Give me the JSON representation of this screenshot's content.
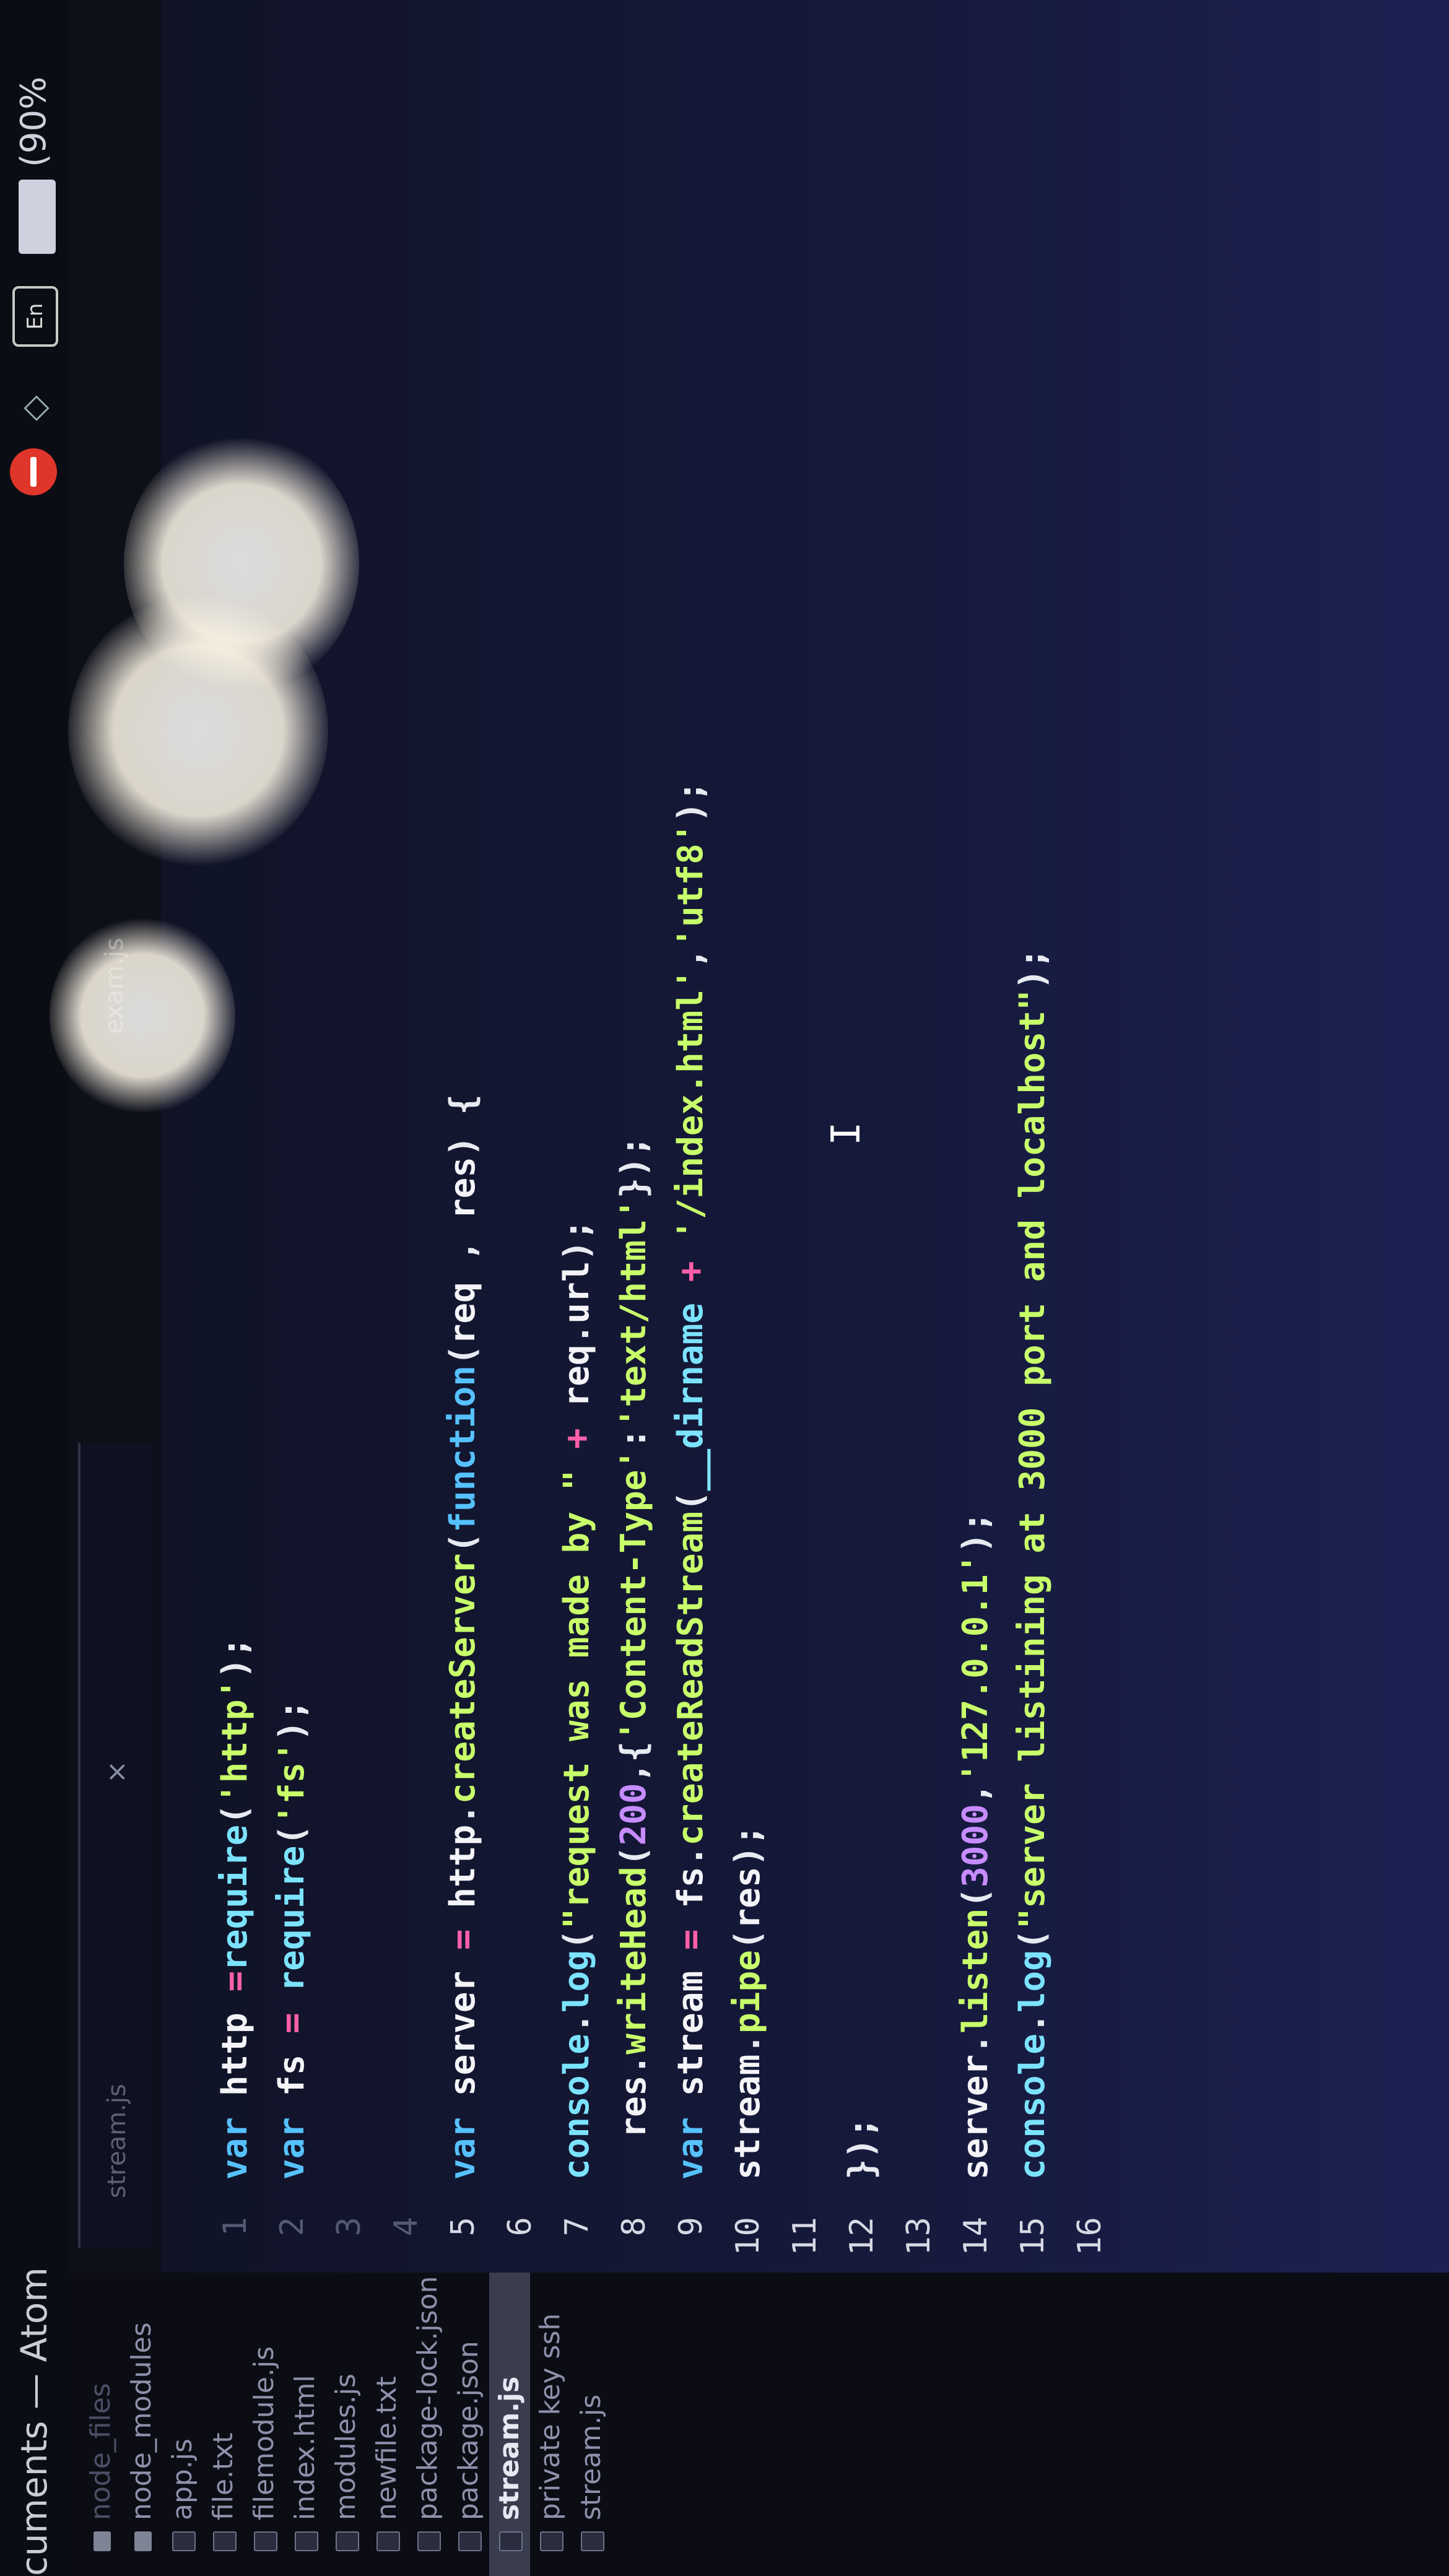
{
  "window": {
    "title": "cuments — Atom"
  },
  "tray": {
    "keyboard_lang": "En",
    "battery": "(90%"
  },
  "tree": {
    "items": [
      {
        "label": "node_files",
        "kind": "folder",
        "dim": true
      },
      {
        "label": "node_modules",
        "kind": "folder"
      },
      {
        "label": "app.js",
        "kind": "file"
      },
      {
        "label": "file.txt",
        "kind": "file"
      },
      {
        "label": "filemodule.js",
        "kind": "file"
      },
      {
        "label": "index.html",
        "kind": "file"
      },
      {
        "label": "modules.js",
        "kind": "file"
      },
      {
        "label": "newfile.txt",
        "kind": "file"
      },
      {
        "label": "package-lock.json",
        "kind": "file"
      },
      {
        "label": "package.json",
        "kind": "file"
      },
      {
        "label": "stream.js",
        "kind": "file",
        "selected": true
      },
      {
        "label": "private key ssh",
        "kind": "file"
      },
      {
        "label": "stream.js",
        "kind": "file"
      }
    ]
  },
  "tabs": {
    "active": "stream.js",
    "other": "exam.js",
    "close_glyph": "×"
  },
  "editor": {
    "line_numbers": [
      "1",
      "2",
      "3",
      "4",
      "5",
      "6",
      "7",
      "8",
      "9",
      "10",
      "11",
      "12",
      "13",
      "14",
      "15",
      "16"
    ],
    "lines": [
      "var http =require('http');",
      "var fs = require('fs');",
      "",
      "",
      "var server = http.createServer(function(req , res) {",
      "",
      "console.log(\"request was made by \" + req.url);",
      "  res.writeHead(200,{'Content-Type':'text/html'});",
      "var stream = fs.createReadStream(__dirname + '/index.html','utf8');",
      "stream.pipe(res);",
      "",
      "});",
      "",
      "server.listen(3000,'127.0.0.1');",
      "console.log(\"server listining at 3000 port and localhost\");",
      ""
    ]
  },
  "icons": [
    "stop-icon",
    "wifi-icon",
    "keyboard-icon",
    "battery-icon",
    "close-icon",
    "file-icon",
    "folder-icon"
  ],
  "colors": {
    "keyword": "#56c1ff",
    "string": "#c8ff6a",
    "number": "#c78cff",
    "operator": "#ff5fa8"
  }
}
